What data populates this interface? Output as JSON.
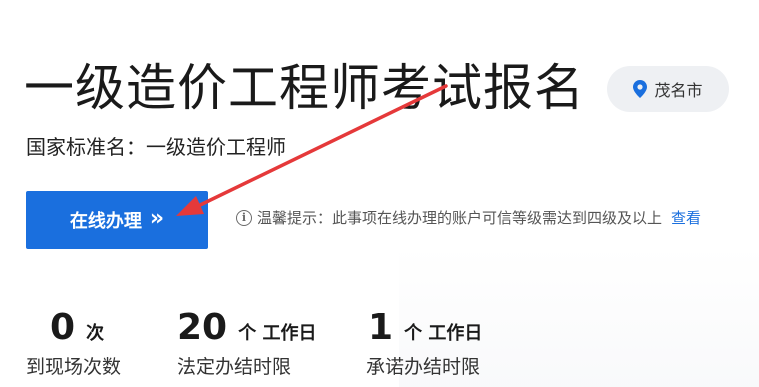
{
  "header": {
    "title": "一级造价工程师考试报名",
    "location": "茂名市"
  },
  "subtitle": "国家标准名：一级造价工程师",
  "action": {
    "online_label": "在线办理",
    "online_chevron": "»"
  },
  "tip": {
    "icon": "i",
    "text": "温馨提示：此事项在线办理的账户可信等级需达到四级及以上",
    "link": "查看"
  },
  "stats": [
    {
      "value": "0",
      "unit": "次",
      "label": "到现场次数"
    },
    {
      "value": "20",
      "unit": "个 工作日",
      "label": "法定办结时限"
    },
    {
      "value": "1",
      "unit": "个 工作日",
      "label": "承诺办结时限"
    }
  ],
  "colors": {
    "accent": "#1a6fde",
    "annotation_arrow": "#e5393a",
    "pill_bg": "#eef0f3"
  },
  "icons": {
    "location": "location-pin-icon",
    "info": "info-circle-icon",
    "arrow": "annotation-arrow"
  }
}
